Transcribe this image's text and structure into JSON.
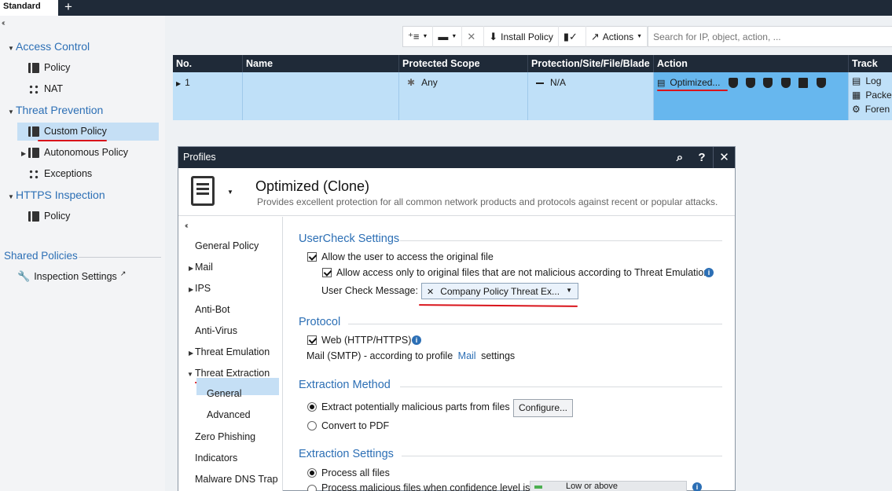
{
  "tabs": {
    "active": "Standard",
    "add": "+"
  },
  "leftnav": {
    "collapse": "‹‹",
    "access_control": "Access Control",
    "policy": "Policy",
    "nat": "NAT",
    "threat_prevention": "Threat Prevention",
    "custom_policy": "Custom Policy",
    "autonomous_policy": "Autonomous Policy",
    "exceptions": "Exceptions",
    "https_inspection": "HTTPS Inspection",
    "https_policy": "Policy",
    "shared_policies": "Shared Policies",
    "inspection_settings": "Inspection Settings"
  },
  "toolbar": {
    "install_policy": "Install Policy",
    "actions": "Actions",
    "search_placeholder": "Search for IP, object, action, ..."
  },
  "table": {
    "headers": [
      "No.",
      "Name",
      "Protected Scope",
      "Protection/Site/File/Blade",
      "Action",
      "Track"
    ],
    "row": {
      "no": "1",
      "name": "",
      "scope": "Any",
      "protection": "N/A",
      "action": "Optimized...",
      "track": [
        "Log",
        "Packe",
        "Foren"
      ]
    }
  },
  "dialog": {
    "title": "Profiles",
    "profile_name": "Optimized (Clone)",
    "profile_desc": "Provides excellent protection for all common network products and protocols against recent or popular attacks.",
    "nav": {
      "collapse": "‹‹",
      "general_policy": "General Policy",
      "mail": "Mail",
      "ips": "IPS",
      "anti_bot": "Anti-Bot",
      "anti_virus": "Anti-Virus",
      "threat_emulation": "Threat Emulation",
      "threat_extraction": "Threat Extraction",
      "general": "General",
      "advanced": "Advanced",
      "zero_phishing": "Zero Phishing",
      "indicators": "Indicators",
      "malware_dns_trap": "Malware DNS Trap"
    },
    "usercheck": {
      "title": "UserCheck Settings",
      "allow_original": "Allow the user to access the original file",
      "allow_only": "Allow access only to original files that are not malicious according to Threat Emulation",
      "message_label": "User Check Message:",
      "message_value": "Company Policy Threat Ex..."
    },
    "protocol": {
      "title": "Protocol",
      "web": "Web (HTTP/HTTPS)",
      "mail_prefix": "Mail (SMTP) - according to profile",
      "mail_link": "Mail",
      "mail_suffix": "settings"
    },
    "extraction_method": {
      "title": "Extraction Method",
      "extract": "Extract potentially malicious parts from files",
      "configure": "Configure...",
      "convert": "Convert to PDF"
    },
    "extraction_settings": {
      "title": "Extraction Settings",
      "process_all": "Process all files",
      "process_malicious": "Process malicious files when confidence level is:",
      "level": "Low or above"
    }
  }
}
